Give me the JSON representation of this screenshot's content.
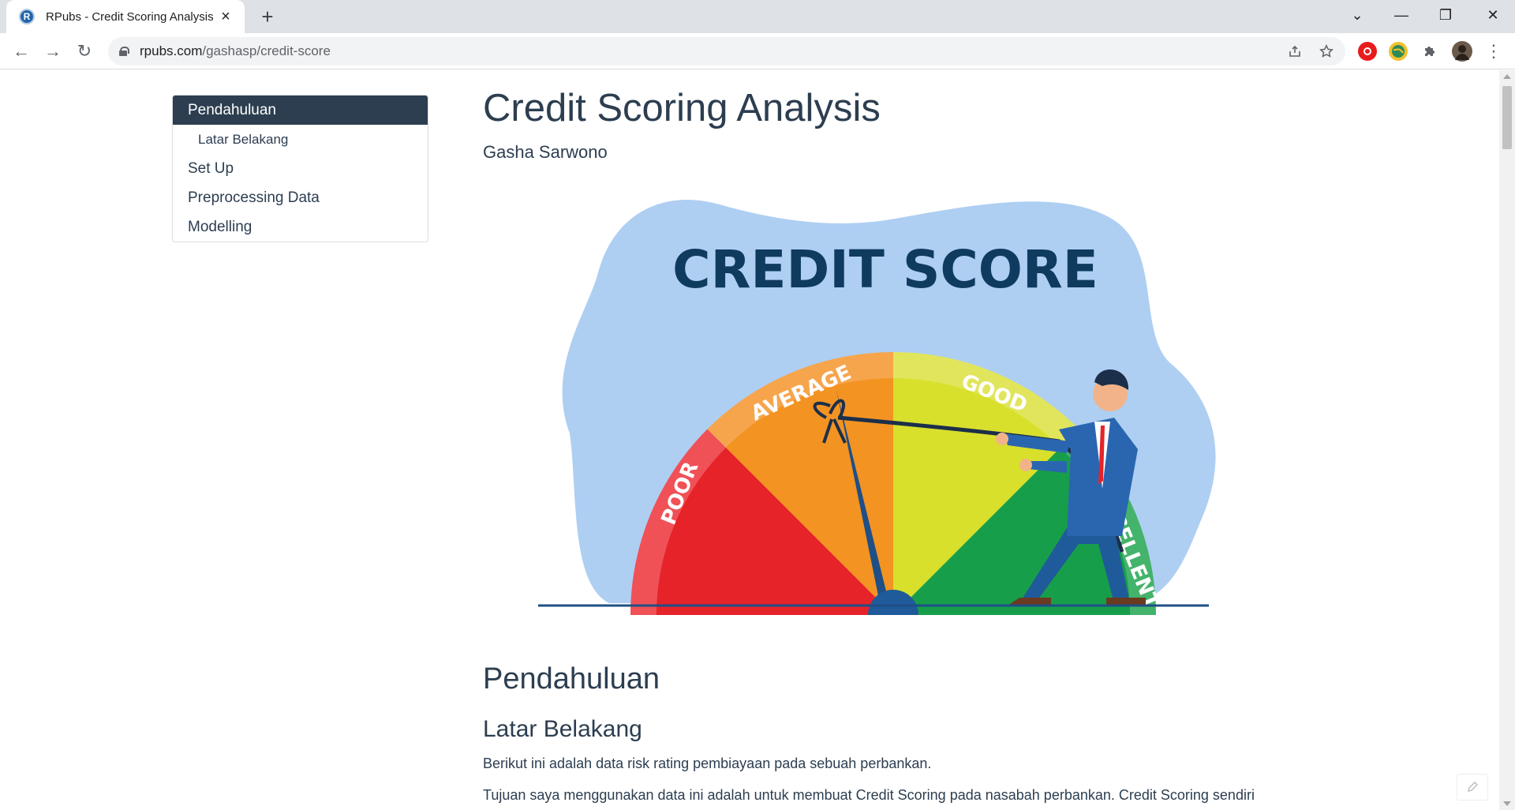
{
  "browser": {
    "tab": {
      "title": "RPubs - Credit Scoring Analysis",
      "favicon_letter": "R",
      "close_icon": "×"
    },
    "new_tab_icon": "+",
    "window_controls": {
      "tab_search": "⌄",
      "minimize": "—",
      "restore": "❐",
      "close": "✕"
    },
    "nav": {
      "back": "←",
      "forward": "→",
      "reload": "↻"
    },
    "address": {
      "host": "rpubs.com",
      "path": "/gashasp/credit-score"
    },
    "menu_icon": "⋮"
  },
  "toc": {
    "items": [
      {
        "label": "Pendahuluan",
        "active": true,
        "level": 1
      },
      {
        "label": "Latar Belakang",
        "active": false,
        "level": 2
      },
      {
        "label": "Set Up",
        "active": false,
        "level": 1
      },
      {
        "label": "Preprocessing Data",
        "active": false,
        "level": 1
      },
      {
        "label": "Modelling",
        "active": false,
        "level": 1
      }
    ]
  },
  "article": {
    "title": "Credit Scoring Analysis",
    "author": "Gasha Sarwono",
    "hero": {
      "heading": "CREDIT SCORE",
      "segments": [
        "POOR",
        "AVERAGE",
        "GOOD",
        "EXCELLENT"
      ],
      "colors": {
        "blob": "#aecff2",
        "poor": "#e52329",
        "average": "#f39321",
        "good": "#d8e02c",
        "excellent": "#179e4a",
        "heading": "#0f3b5f"
      }
    },
    "section_heading": "Pendahuluan",
    "subsection_heading": "Latar Belakang",
    "paragraph_1": "Berikut ini adalah data risk rating pembiayaan pada sebuah perbankan.",
    "paragraph_2": "Tujuan saya menggunakan data ini adalah untuk membuat Credit Scoring pada nasabah perbankan. Credit Scoring sendiri"
  },
  "theme": {
    "text": "#2c3e50",
    "toc_active_bg": "#2c3e50"
  }
}
